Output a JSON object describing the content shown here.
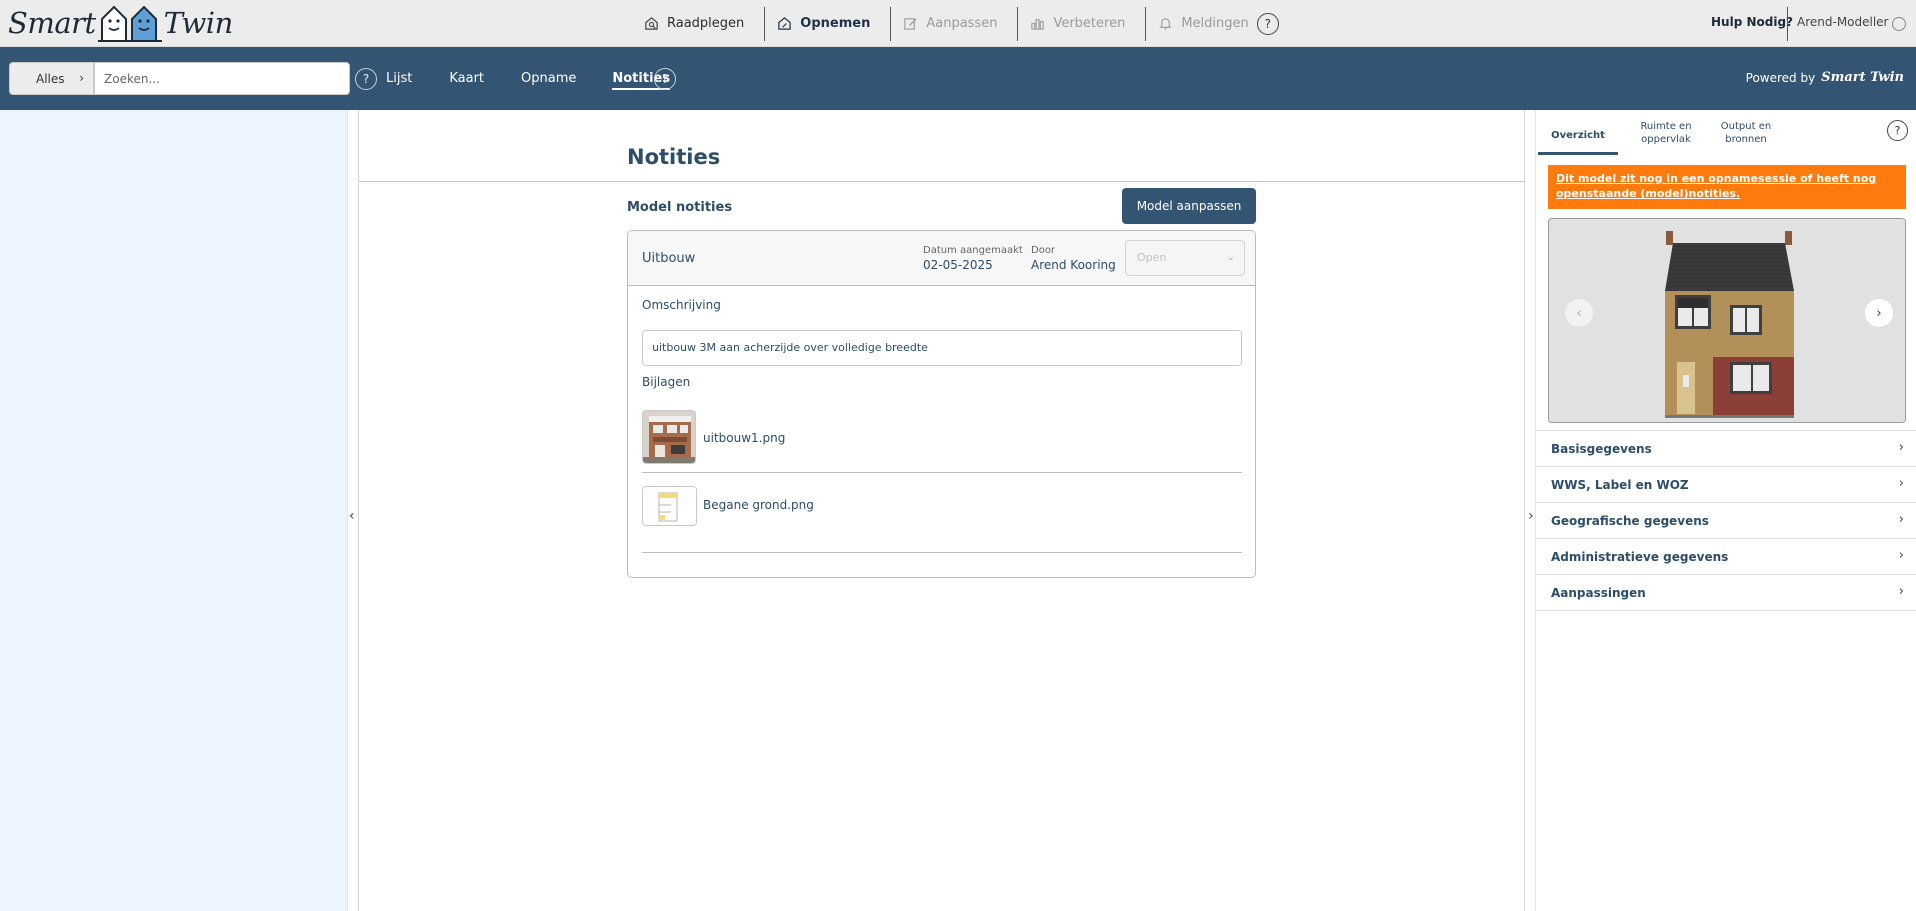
{
  "brand": {
    "word_left": "Smart",
    "word_right": "Twin"
  },
  "topnav": {
    "items": [
      {
        "label": "Raadplegen",
        "icon": "search-home-icon"
      },
      {
        "label": "Opnemen",
        "icon": "home-edit-icon"
      },
      {
        "label": "Aanpassen",
        "icon": "pencil-icon"
      },
      {
        "label": "Verbeteren",
        "icon": "buildings-icon"
      },
      {
        "label": "Meldingen",
        "icon": "bell-icon"
      }
    ],
    "help_symbol": "?",
    "help_link": "Hulp Nodig?",
    "user": "Arend-Modeller"
  },
  "navbar": {
    "scope_label": "Alles",
    "scope_chevron": "›",
    "search_placeholder": "Zoeken...",
    "help_symbol": "?",
    "tabs": [
      "Lijst",
      "Kaart",
      "Opname",
      "Notities"
    ],
    "active_tab": "Notities",
    "powered_by": "Powered by",
    "powered_brand": "Smart Twin"
  },
  "toggles": {
    "left": "‹",
    "right": "›"
  },
  "main": {
    "title": "Notities",
    "section_label": "Model notities",
    "model_button": "Model aanpassen",
    "note": {
      "name": "Uitbouw",
      "date_label": "Datum aangemaakt",
      "date_value": "02-05-2025",
      "author_label": "Door",
      "author_value": "Arend Kooring",
      "status": "Open",
      "status_caret": "⌄",
      "description_label": "Omschrijving",
      "description": "uitbouw 3M aan acherzijde over volledige breedte",
      "attachments_label": "Bijlagen",
      "attachments": [
        {
          "name": "uitbouw1.png"
        },
        {
          "name": "Begane grond.png"
        }
      ]
    }
  },
  "right_panel": {
    "tabs": [
      {
        "line1": "Overzicht",
        "line2": ""
      },
      {
        "line1": "Ruimte en",
        "line2": "oppervlak"
      },
      {
        "line1": "Output en",
        "line2": "bronnen"
      }
    ],
    "help_symbol": "?",
    "warning": "Dit model zit nog in een opnamesessie of heeft nog openstaande (model)notities.",
    "accent_color": "#ff7b0e",
    "carousel": {
      "prev": "‹",
      "next": "›"
    },
    "sections": [
      "Basisgegevens",
      "WWS, Label en WOZ",
      "Geografische gegevens",
      "Administratieve gegevens",
      "Aanpassingen"
    ],
    "section_chevron": "›"
  }
}
